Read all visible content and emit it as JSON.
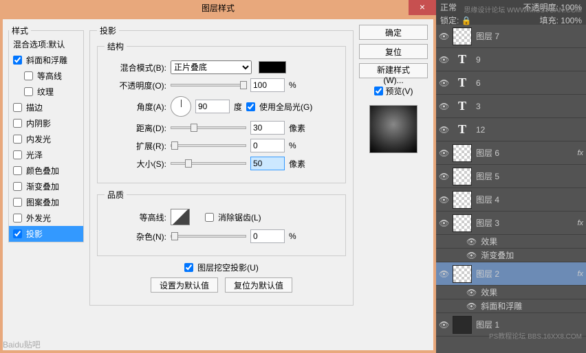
{
  "dialog": {
    "title": "图层样式",
    "close": "×",
    "styles_legend": "样式",
    "style_items": [
      "混合选项:默认",
      "斜面和浮雕",
      "等高线",
      "纹理",
      "描边",
      "内阴影",
      "内发光",
      "光泽",
      "颜色叠加",
      "渐变叠加",
      "图案叠加",
      "外发光",
      "投影"
    ],
    "style_checked": {
      "斜面和浮雕": true,
      "投影": true
    },
    "shadow_legend": "投影",
    "struct_legend": "结构",
    "blend_label": "混合模式(B):",
    "blend_value": "正片叠底",
    "opacity_label": "不透明度(O):",
    "opacity_value": "100",
    "percent": "%",
    "angle_label": "角度(A):",
    "angle_value": "90",
    "degree": "度",
    "global_light": "使用全局光(G)",
    "distance_label": "距离(D):",
    "distance_value": "30",
    "px": "像素",
    "spread_label": "扩展(R):",
    "spread_value": "0",
    "size_label": "大小(S):",
    "size_value": "50",
    "quality_legend": "品质",
    "contour_label": "等高线:",
    "antialias": "消除锯齿(L)",
    "noise_label": "杂色(N):",
    "noise_value": "0",
    "knockout": "图层挖空投影(U)",
    "reset_default": "设置为默认值",
    "restore_default": "复位为默认值",
    "ok": "确定",
    "cancel": "复位",
    "new_style": "新建样式(W)...",
    "preview": "预览(V)"
  },
  "panel": {
    "top1": "正常",
    "opacity_lbl": "不透明度:",
    "opacity_v": "100%",
    "lock_lbl": "锁定:",
    "fill_lbl": "填充:",
    "fill_v": "100%",
    "effects_label": "效果",
    "layers": [
      {
        "type": "img",
        "name": "图层 7"
      },
      {
        "type": "T",
        "name": "9"
      },
      {
        "type": "T",
        "name": "6"
      },
      {
        "type": "T",
        "name": "3"
      },
      {
        "type": "T",
        "name": "12"
      },
      {
        "type": "img",
        "name": "图层 6",
        "fx": true
      },
      {
        "type": "img",
        "name": "图层 5"
      },
      {
        "type": "img",
        "name": "图层 4"
      },
      {
        "type": "img",
        "name": "图层 3",
        "fx": true,
        "effects": [
          "渐变叠加"
        ]
      },
      {
        "type": "img",
        "name": "图层 2",
        "fx": true,
        "selected": true,
        "effects": [
          "斜面和浮雕"
        ]
      },
      {
        "type": "dark",
        "name": "图层 1"
      }
    ]
  },
  "watermarks": {
    "w1": "思缘设计论坛 WWW.MISSYUAN.COM",
    "w2": "PS教程论坛 BBS.16XX8.COM",
    "w3": "Baidu贴吧"
  }
}
